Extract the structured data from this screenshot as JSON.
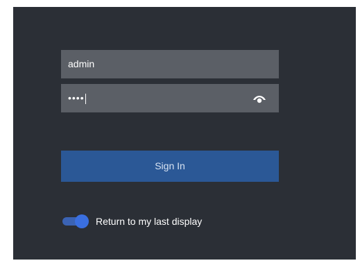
{
  "login": {
    "username_value": "admin",
    "password_mask": "••••",
    "signin_label": "Sign In",
    "remember_label": "Return to my last display",
    "remember_enabled": true
  },
  "icons": {
    "reveal_password": "eye-icon"
  },
  "colors": {
    "panel_background": "#2b2f36",
    "field_background": "#5b5f66",
    "primary_button": "#2b5896",
    "toggle_accent": "#3a6fe0"
  }
}
